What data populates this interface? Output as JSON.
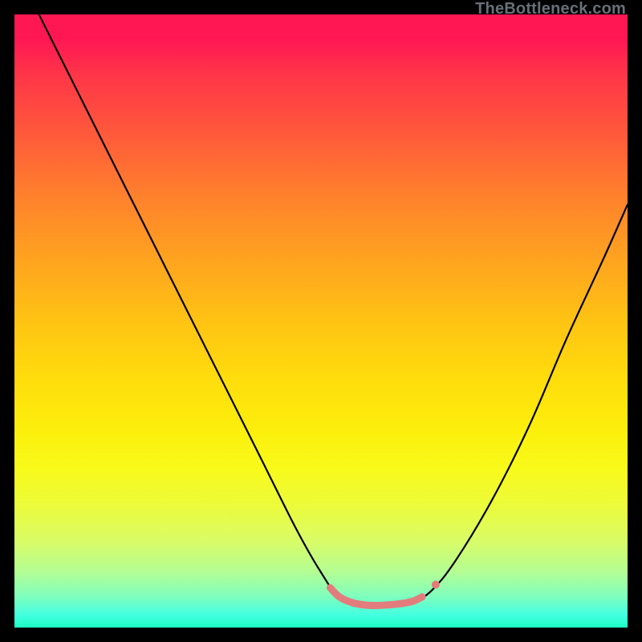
{
  "watermark": "TheBottleneck.com",
  "chart_data": {
    "type": "line",
    "title": "",
    "xlabel": "",
    "ylabel": "",
    "xlim": [
      0,
      100
    ],
    "ylim": [
      0,
      100
    ],
    "grid": false,
    "legend": false,
    "note": "Axes are normalized 0-100 in plot-area coordinates; the curve is a V-shaped bottleneck profile with a flat minimum near y≈96 over x≈52-67, a highlighted salmon segment along the trough, and a small salmon marker on the right rising branch.",
    "series": [
      {
        "name": "bottleneck-curve",
        "color": "#000000",
        "points": [
          {
            "x": 4.0,
            "y": 0.0
          },
          {
            "x": 10.0,
            "y": 12.0
          },
          {
            "x": 16.0,
            "y": 24.0
          },
          {
            "x": 22.0,
            "y": 36.0
          },
          {
            "x": 28.0,
            "y": 48.0
          },
          {
            "x": 34.0,
            "y": 60.0
          },
          {
            "x": 40.0,
            "y": 72.0
          },
          {
            "x": 46.0,
            "y": 84.0
          },
          {
            "x": 50.0,
            "y": 91.0
          },
          {
            "x": 53.0,
            "y": 95.0
          },
          {
            "x": 57.0,
            "y": 96.3
          },
          {
            "x": 61.0,
            "y": 96.3
          },
          {
            "x": 65.0,
            "y": 95.7
          },
          {
            "x": 68.0,
            "y": 94.0
          },
          {
            "x": 72.0,
            "y": 89.0
          },
          {
            "x": 78.0,
            "y": 79.0
          },
          {
            "x": 84.0,
            "y": 67.0
          },
          {
            "x": 90.0,
            "y": 53.0
          },
          {
            "x": 96.0,
            "y": 40.0
          },
          {
            "x": 100.0,
            "y": 31.0
          }
        ]
      },
      {
        "name": "trough-highlight",
        "color": "#e37c7c",
        "stroke_width": 9,
        "points": [
          {
            "x": 51.5,
            "y": 93.5
          },
          {
            "x": 53.0,
            "y": 95.0
          },
          {
            "x": 55.0,
            "y": 95.9
          },
          {
            "x": 57.0,
            "y": 96.3
          },
          {
            "x": 59.0,
            "y": 96.4
          },
          {
            "x": 61.0,
            "y": 96.3
          },
          {
            "x": 63.0,
            "y": 96.1
          },
          {
            "x": 65.0,
            "y": 95.7
          },
          {
            "x": 66.5,
            "y": 95.0
          }
        ]
      }
    ],
    "markers": [
      {
        "name": "right-dot",
        "x": 68.7,
        "y": 93.0,
        "r": 5,
        "color": "#e37c7c"
      }
    ]
  }
}
